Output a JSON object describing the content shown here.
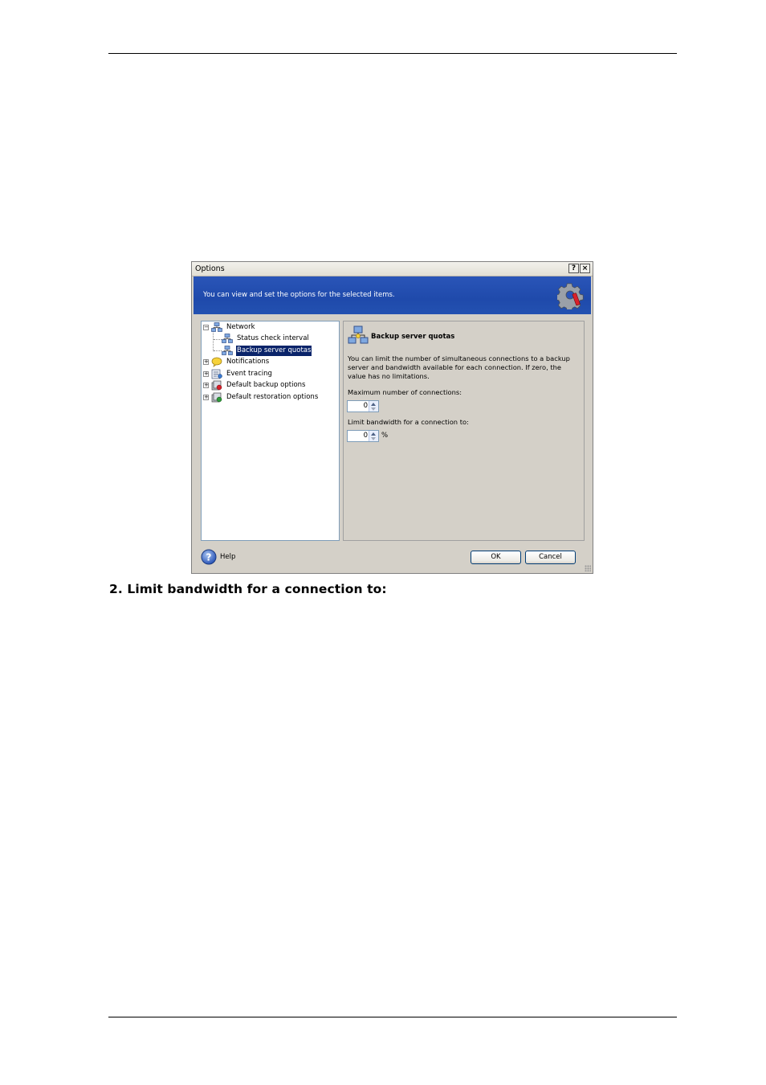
{
  "heading": "2. Limit bandwidth for a connection to:",
  "dialog": {
    "title": "Options",
    "help_btn": "?",
    "close_btn": "×",
    "banner_text": "You can view and set the options for the selected items.",
    "tree": [
      {
        "label": "Network",
        "expander": "−"
      },
      {
        "label": "Status check interval"
      },
      {
        "label": "Backup server quotas"
      },
      {
        "label": "Notifications",
        "expander": "+"
      },
      {
        "label": "Event tracing",
        "expander": "+"
      },
      {
        "label": "Default backup options",
        "expander": "+"
      },
      {
        "label": "Default restoration options",
        "expander": "+"
      }
    ],
    "panel": {
      "title": "Backup server quotas",
      "description": "You can limit the number of simultaneous connections to a backup server and bandwidth available for each connection. If zero, the value has no limitations.",
      "max_connections_label": "Maximum number of connections:",
      "max_connections_value": "0",
      "bandwidth_label": "Limit bandwidth for a connection to:",
      "bandwidth_value": "0",
      "bandwidth_unit": "%"
    },
    "help_label": "Help",
    "ok_label": "OK",
    "cancel_label": "Cancel"
  }
}
